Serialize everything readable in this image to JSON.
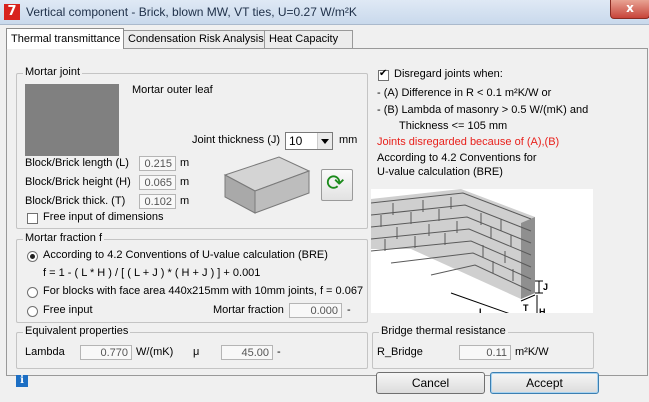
{
  "window": {
    "title": "Vertical component - Brick, blown MW, VT ties, U=0.27 W/m²K",
    "app_icon": "7",
    "close_glyph": "x"
  },
  "tabs": [
    {
      "label": "Thermal transmittance",
      "active": true
    },
    {
      "label": "Condensation Risk Analysis",
      "active": false
    },
    {
      "label": "Heat Capacity",
      "active": false
    }
  ],
  "mortar_joint": {
    "title": "Mortar joint",
    "swatch_color": "#808080",
    "material": "Mortar outer leaf",
    "joint_thickness_label": "Joint thickness (J)",
    "joint_thickness_value": "10",
    "joint_thickness_unit": "mm",
    "length_label": "Block/Brick length (L)",
    "length_value": "0.215",
    "height_label": "Block/Brick height (H)",
    "height_value": "0.065",
    "thick_label": "Block/Brick thick. (T)",
    "thick_value": "0.102",
    "unit_m": "m",
    "free_input_label": "Free input of dimensions",
    "free_input_checked": false
  },
  "mortar_fraction": {
    "title": "Mortar fraction f",
    "option1_label": "According to 4.2 Conventions of U-value calculation (BRE)",
    "formula": "f = 1 - ( L * H ) / [ ( L + J ) * ( H + J ) ] + 0.001",
    "option2_label": "For blocks with face area 440x215mm with 10mm joints, f = 0.067",
    "option3_label": "Free input",
    "fraction_label": "Mortar fraction",
    "fraction_value": "0.000",
    "fraction_unit": "-",
    "selected": 1
  },
  "disregard": {
    "checkbox_label": "Disregard joints when:",
    "checked": true,
    "line1": "- (A) Difference in R < 0.1 m²K/W or",
    "line2": "- (B) Lambda of masonry > 0.5 W/(mK) and",
    "line3": "Thickness <= 105 mm",
    "status": "Joints disregarded because of (A),(B)",
    "status_color": "#e8211c",
    "note1": "According to 4.2 Conventions for",
    "note2": "U-value calculation (BRE)"
  },
  "diagram": {
    "label_j": "J",
    "label_h": "H",
    "label_l": "L",
    "label_t": "T"
  },
  "equivalent": {
    "title": "Equivalent properties",
    "lambda_label": "Lambda",
    "lambda_value": "0.770",
    "lambda_unit": "W/(mK)",
    "mu_label": "μ",
    "mu_value": "45.00",
    "mu_unit": "-"
  },
  "bridge": {
    "title": "Bridge thermal resistance",
    "r_label": "R_Bridge",
    "r_value": "0.11",
    "r_unit": "m²K/W"
  },
  "buttons": {
    "cancel": "Cancel",
    "accept": "Accept"
  },
  "info_glyph": "i",
  "swap_glyph": "⟳"
}
